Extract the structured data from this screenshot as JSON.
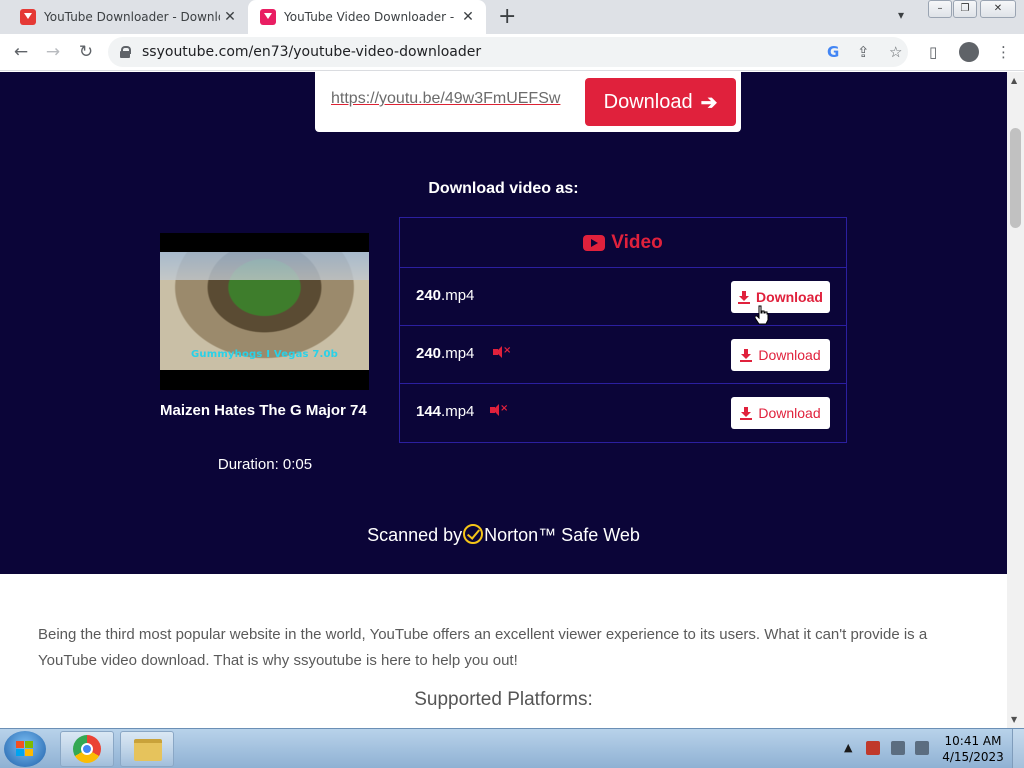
{
  "browser": {
    "tabs": [
      {
        "title": "YouTube Downloader - Download",
        "close": "✕"
      },
      {
        "title": "YouTube Video Downloader - SSY",
        "close": "✕"
      }
    ],
    "new_tab": "+",
    "url": "ssyoutube.com/en73/youtube-video-downloader"
  },
  "form": {
    "input_value": "https://youtu.be/49w3FmUEFSw",
    "button_label": "Download",
    "button_arrow": "➔"
  },
  "result": {
    "heading": "Download video as:",
    "thumbnail_caption": "Gummyhogs I Vegas 7.0b",
    "video_title": "Maizen Hates The G Major 74",
    "duration": "Duration: 0:05",
    "table_header": "Video",
    "rows": [
      {
        "quality": "240",
        "ext": ".mp4",
        "muted": false,
        "button": "Download"
      },
      {
        "quality": "240",
        "ext": ".mp4",
        "muted": true,
        "button": "Download"
      },
      {
        "quality": "144",
        "ext": ".mp4",
        "muted": true,
        "button": "Download"
      }
    ]
  },
  "norton": {
    "prefix": "Scanned by",
    "brand": "Norton™ Safe Web"
  },
  "about": {
    "text": "Being the third most popular website in the world, YouTube offers an excellent viewer experience to its users. What it can't provide is a YouTube video download. That is why ssyoutube is here to help you out!",
    "platforms_heading": "Supported Platforms:"
  },
  "taskbar": {
    "time": "10:41 AM",
    "date": "4/15/2023"
  },
  "colors": {
    "hero_bg": "#0b0538",
    "accent": "#e0213c",
    "table_border": "#2b1fa0"
  }
}
